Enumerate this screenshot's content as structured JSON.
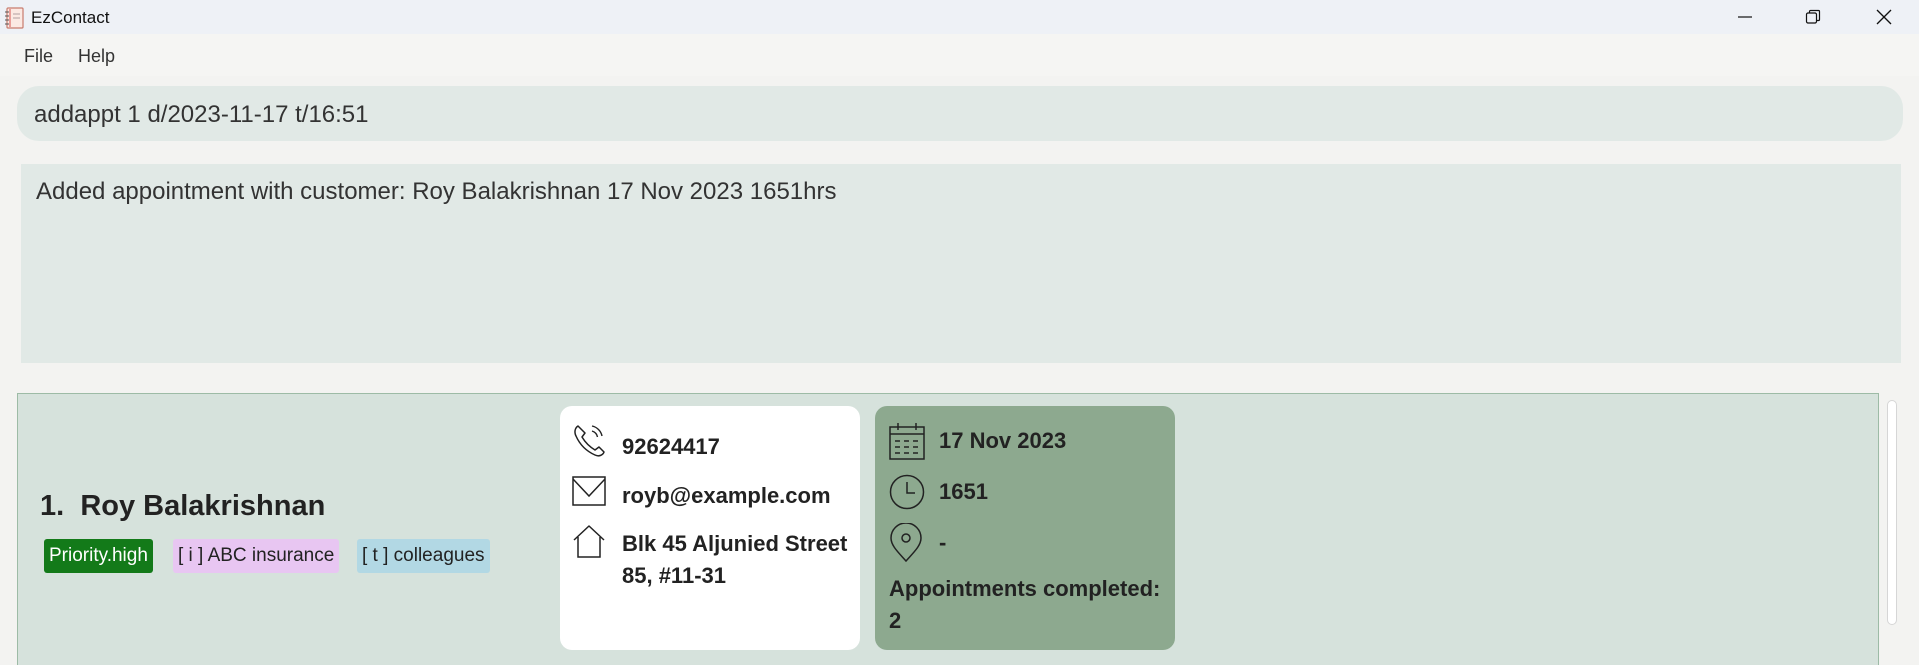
{
  "window": {
    "title": "EzContact",
    "controls": [
      "minimize",
      "restore",
      "close"
    ]
  },
  "menu": {
    "file": "File",
    "help": "Help"
  },
  "command": {
    "value": "addappt 1 d/2023-11-17 t/16:51"
  },
  "result": {
    "message": "Added appointment with customer: Roy Balakrishnan 17 Nov 2023 1651hrs"
  },
  "person_list": [
    {
      "index": "1.",
      "name": "Roy Balakrishnan",
      "tags": [
        {
          "label": "Priority.high",
          "color": "#137a19"
        },
        {
          "label": "[ i ] ABC insurance",
          "color": "#e8c6f2"
        },
        {
          "label": "[ t ] colleagues",
          "color": "#b2d8e4"
        }
      ],
      "contact": {
        "phone": "92624417",
        "email": "royb@example.com",
        "address_line1": "Blk 45 Aljunied Street",
        "address_line2": "85, #11-31",
        "icons": [
          "phone-icon",
          "email-icon",
          "home-icon"
        ]
      },
      "appointment": {
        "date": "17 Nov 2023",
        "time": "1651",
        "venue": "-",
        "completed_label": "Appointments completed:",
        "completed_count": "2",
        "icons": [
          "calendar-icon",
          "clock-icon",
          "location-pin-icon"
        ]
      }
    }
  ],
  "colors": {
    "panel_bg": "#e1e9e6",
    "list_bg": "#d6e2dc",
    "appointment_card": "#8da98f",
    "contact_card": "#ffffff"
  }
}
